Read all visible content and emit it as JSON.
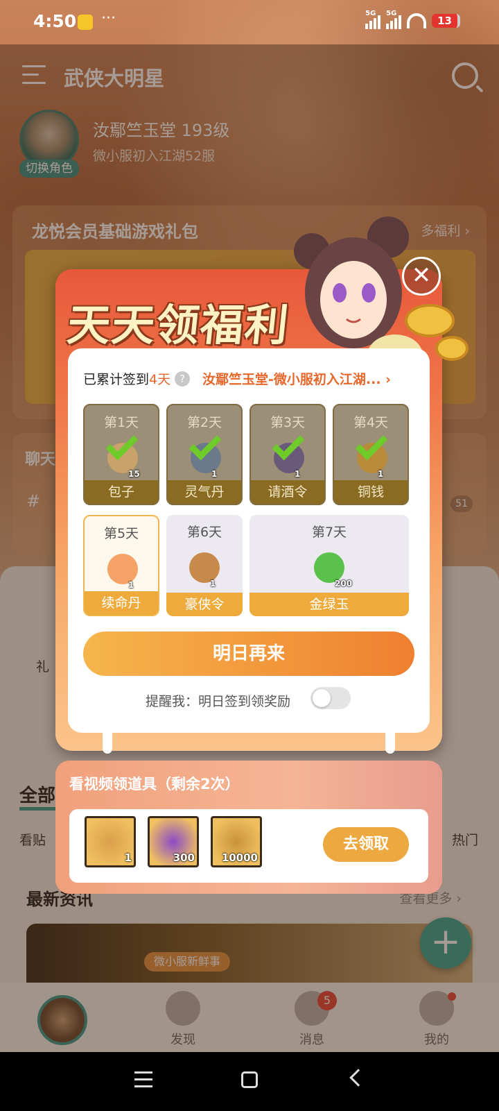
{
  "status_bar": {
    "time": "4:50",
    "dots": "···",
    "net1": "5G",
    "net2": "5G",
    "battery": "13"
  },
  "header": {
    "title": "武侠大明星"
  },
  "profile": {
    "name": "汝鄢竺玉堂 193级",
    "server": "微小服初入江湖52服",
    "switch_role": "切换角色"
  },
  "gift_card": {
    "title": "龙悦会员基础游戏礼包",
    "more": "多福利 ›"
  },
  "chat_card": {
    "title": "聊天",
    "hash": "#",
    "count": "51"
  },
  "lower": {
    "gift_label": "礼",
    "all_tab": "全部",
    "view_posts": "看贴",
    "hot": "热门",
    "news_title": "最新资讯",
    "news_more": "查看更多 ›",
    "news_chip": "微小服新鲜事"
  },
  "modal": {
    "title": "天天领福利",
    "signin_prefix": "已累计签到",
    "signin_days": "4天",
    "help": "?",
    "role": "汝鄢竺玉堂-微小服初入江湖... ›",
    "close": "✕",
    "days": [
      {
        "label": "第1天",
        "item": "包子",
        "qty": "15",
        "state": "claimed",
        "color": "#c8a26a"
      },
      {
        "label": "第2天",
        "item": "灵气丹",
        "qty": "1",
        "state": "claimed",
        "color": "#6a7a8a"
      },
      {
        "label": "第3天",
        "item": "请酒令",
        "qty": "1",
        "state": "claimed",
        "color": "#6a5a7a"
      },
      {
        "label": "第4天",
        "item": "铜钱",
        "qty": "1",
        "state": "claimed",
        "color": "#b88a3a"
      },
      {
        "label": "第5天",
        "item": "续命丹",
        "qty": "1",
        "state": "today",
        "color": "#f4a266"
      },
      {
        "label": "第6天",
        "item": "豪侠令",
        "qty": "1",
        "state": "future",
        "color": "#c88a4a"
      },
      {
        "label": "第7天",
        "item": "金绿玉",
        "qty": "200",
        "state": "future",
        "color": "#5ac24a"
      }
    ],
    "button": "明日再来",
    "remind": "提醒我：明日签到领奖励"
  },
  "video": {
    "title": "看视频领道具（剩余2次）",
    "items": [
      {
        "qty": "1",
        "color": "#d9a04a",
        "icon": "token-icon"
      },
      {
        "qty": "300",
        "color": "#8a4ac8",
        "icon": "orb-icon"
      },
      {
        "qty": "10000",
        "color": "#c8943a",
        "icon": "coin-icon"
      }
    ],
    "button": "去领取"
  },
  "nav": {
    "discover": "发现",
    "messages": "消息",
    "mine": "我的",
    "badge": "5"
  }
}
